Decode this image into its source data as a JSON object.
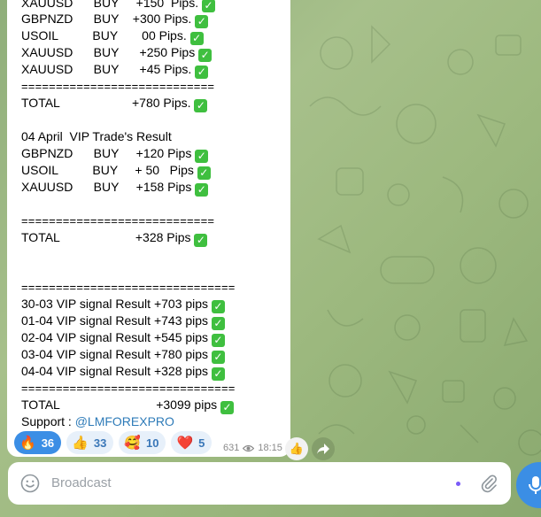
{
  "message": {
    "lines": [
      {
        "text": "XAUUSD      BUY     +150  Pips.",
        "check": true
      },
      {
        "text": "GBPNZD      BUY    +300 Pips.",
        "check": true
      },
      {
        "text": "USOIL          BUY       00 Pips.",
        "check": true
      },
      {
        "text": "XAUUSD      BUY      +250 Pips",
        "check": true
      },
      {
        "text": "XAUUSD      BUY      +45 Pips.",
        "check": true
      },
      {
        "text": "============================",
        "check": false
      },
      {
        "text": "TOTAL                     +780 Pips.",
        "check": true
      },
      {
        "text": "04 April  VIP Trade's Result",
        "check": false
      },
      {
        "text": "GBPNZD      BUY     +120 Pips",
        "check": true
      },
      {
        "text": "USOIL          BUY     + 50   Pips",
        "check": true
      },
      {
        "text": "XAUUSD      BUY     +158 Pips",
        "check": true
      },
      {
        "text": "============================",
        "check": false
      },
      {
        "text": "TOTAL                      +328 Pips",
        "check": true
      },
      {
        "text": "===============================",
        "check": false
      },
      {
        "text": "30-03 VIP signal Result +703 pips",
        "check": true
      },
      {
        "text": "01-04 VIP signal Result +743 pips",
        "check": true
      },
      {
        "text": "02-04 VIP signal Result +545 pips",
        "check": true
      },
      {
        "text": "03-04 VIP signal Result +780 pips",
        "check": true
      },
      {
        "text": "04-04 VIP signal Result +328 pips",
        "check": true
      },
      {
        "text": "===============================",
        "check": false
      },
      {
        "text": "TOTAL                            +3099 pips",
        "check": true
      }
    ],
    "support_label": "Support : ",
    "support_link": "@LMFOREXPRO",
    "check_glyph": "✓"
  },
  "reactions": [
    {
      "emoji": "🔥",
      "icon": "fire-icon",
      "count": "36",
      "active": true
    },
    {
      "emoji": "👍",
      "icon": "thumbs-up-icon",
      "count": "33",
      "active": false
    },
    {
      "emoji": "🥰",
      "icon": "smiling-hearts-icon",
      "count": "10",
      "active": false
    },
    {
      "emoji": "❤️",
      "icon": "red-heart-icon",
      "count": "5",
      "active": false
    }
  ],
  "meta": {
    "views": "631",
    "time": "18:15"
  },
  "quick_reaction": "👍",
  "composer": {
    "placeholder": "Broadcast"
  },
  "colors": {
    "accent": "#3b8ee5",
    "check": "#3fbf3f",
    "link": "#2e7bb8"
  }
}
